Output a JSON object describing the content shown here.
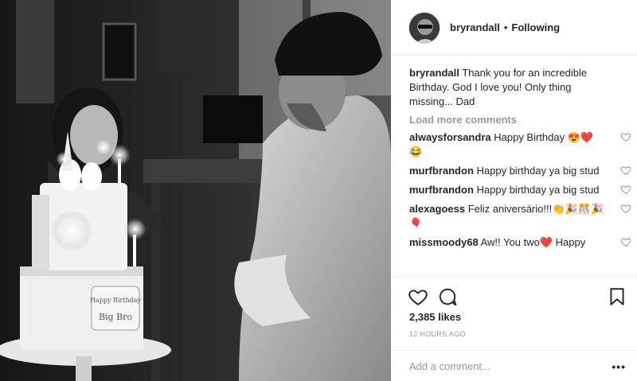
{
  "post": {
    "username": "bryrandall",
    "separator": "•",
    "follow_status": "Following",
    "caption_user": "bryrandall",
    "caption_text": "Thank you for an incredible Birthday. God I love you! Only thing missing... Dad",
    "load_more": "Load more comments",
    "comments": [
      {
        "user": "alwaysforsandra",
        "text": "Happy Birthday 😍❤️😂"
      },
      {
        "user": "murfbrandon",
        "text": "Happy birthday ya big stud"
      },
      {
        "user": "murfbrandon",
        "text": "Happy birthday ya big stud"
      },
      {
        "user": "alexagoess",
        "text": "Feliz aniversário!!!👏🎉🎊🎉🎈"
      },
      {
        "user": "missmoody68",
        "text": "Aw!! You two❤️ Happy"
      }
    ],
    "likes": "2,385 likes",
    "timestamp": "12 HOURS AGO",
    "add_comment_placeholder": "Add a comment...",
    "more_glyph": "•••"
  },
  "photo": {
    "cake_plaque_text": "Happy Birthday Big Bro",
    "icon_names": [
      "heart-icon",
      "comment-icon",
      "bookmark-icon",
      "more-options-icon"
    ]
  }
}
